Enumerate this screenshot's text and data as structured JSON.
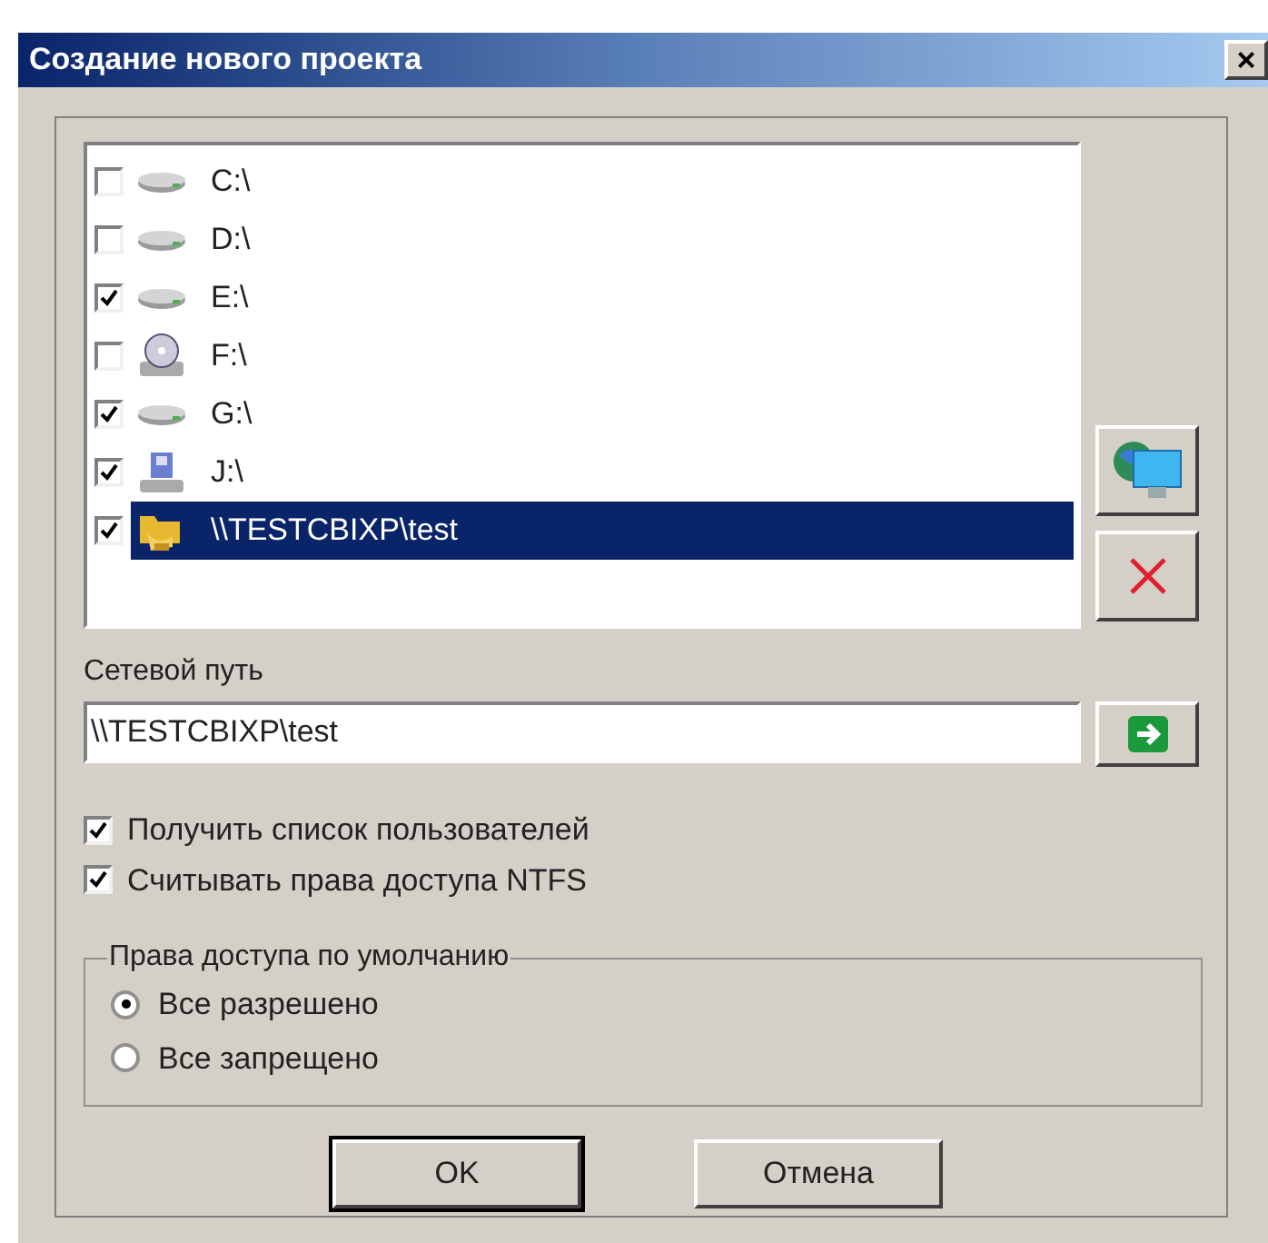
{
  "window": {
    "title": "Создание нового проекта",
    "close": "×"
  },
  "drives": [
    {
      "label": "C:\\",
      "kind": "hdd",
      "checked": false,
      "selected": false
    },
    {
      "label": "D:\\",
      "kind": "hdd",
      "checked": false,
      "selected": false
    },
    {
      "label": "E:\\",
      "kind": "hdd",
      "checked": true,
      "selected": false
    },
    {
      "label": "F:\\",
      "kind": "cdrom",
      "checked": false,
      "selected": false
    },
    {
      "label": "G:\\",
      "kind": "hdd",
      "checked": true,
      "selected": false
    },
    {
      "label": "J:\\",
      "kind": "netdrive",
      "checked": true,
      "selected": false
    },
    {
      "label": "\\\\TESTCBIXP\\test",
      "kind": "share",
      "checked": true,
      "selected": true
    }
  ],
  "network_path": {
    "label": "Сетевой путь",
    "value": "\\\\TESTCBIXP\\test"
  },
  "options": [
    {
      "label": "Получить список пользователей",
      "checked": true
    },
    {
      "label": "Считывать права доступа NTFS",
      "checked": true
    }
  ],
  "default_access": {
    "title": "Права доступа по умолчанию",
    "choices": [
      {
        "label": "Все разрешено",
        "selected": true
      },
      {
        "label": "Все запрещено",
        "selected": false
      }
    ]
  },
  "buttons": [
    {
      "label": "OK",
      "default": true
    },
    {
      "label": "Отмена",
      "default": false
    }
  ]
}
